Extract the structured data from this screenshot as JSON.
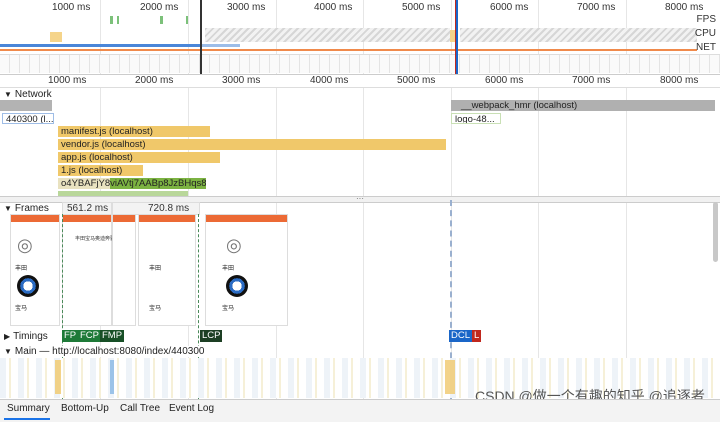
{
  "overview": {
    "ticks": [
      "1000 ms",
      "2000 ms",
      "3000 ms",
      "4000 ms",
      "5000 ms",
      "6000 ms",
      "7000 ms",
      "8000 ms"
    ],
    "track_labels": {
      "fps": "FPS",
      "cpu": "CPU",
      "net": "NET"
    }
  },
  "ruler": {
    "ticks": [
      "1000 ms",
      "2000 ms",
      "3000 ms",
      "4000 ms",
      "5000 ms",
      "6000 ms",
      "7000 ms",
      "8000 ms"
    ]
  },
  "network": {
    "title": "Network",
    "requests": [
      {
        "label": "440300 (l...",
        "color": "#b9d3f0"
      },
      {
        "label": "manifest.js (localhost)",
        "color": "#f0c86a"
      },
      {
        "label": "vendor.js (localhost)",
        "color": "#f0c86a"
      },
      {
        "label": "app.js (localhost)",
        "color": "#f0c86a"
      },
      {
        "label": "1.js (localhost)",
        "color": "#f0c86a"
      },
      {
        "label": "o4YBAFjY8viAVtj7AABp8JzBHqs8...",
        "color": "#7cb342"
      },
      {
        "label": "__webpack_hmr (localhost)",
        "color": "#a9a9a9"
      },
      {
        "label": "logo-48...",
        "color": "#a7d08c"
      }
    ]
  },
  "frames": {
    "title": "Frames",
    "durations": [
      "561.2 ms",
      "720.8 ms"
    ],
    "screens": [
      {
        "brand1": "丰田",
        "brand2": "宝马"
      },
      {
        "brand1": "丰田宝马奥迪奔驰",
        "brand2": ""
      },
      {
        "brand1": "丰田",
        "brand2": "宝马"
      },
      {
        "brand1": "丰田",
        "brand2": "宝马"
      }
    ]
  },
  "timings": {
    "title": "Timings",
    "markers": [
      {
        "label": "FP",
        "color": "#1e7a38"
      },
      {
        "label": "FCP",
        "color": "#1e7a38"
      },
      {
        "label": "FMP",
        "color": "#174f26"
      },
      {
        "label": "LCP",
        "color": "#1d3f24"
      },
      {
        "label": "DCL",
        "color": "#1a66c8"
      },
      {
        "label": "L",
        "color": "#c0281e"
      }
    ]
  },
  "main": {
    "title": "Main — http://localhost:8080/index/440300"
  },
  "watermark": "CSDN @做一个有趣的知乎 @追逐者",
  "tabs": [
    "Summary",
    "Bottom-Up",
    "Call Tree",
    "Event Log"
  ],
  "colors": {
    "accent": "#1a73e8",
    "network_script": "#f0c86a",
    "network_image": "#7cb342",
    "frame_header": "#ec6a35"
  }
}
